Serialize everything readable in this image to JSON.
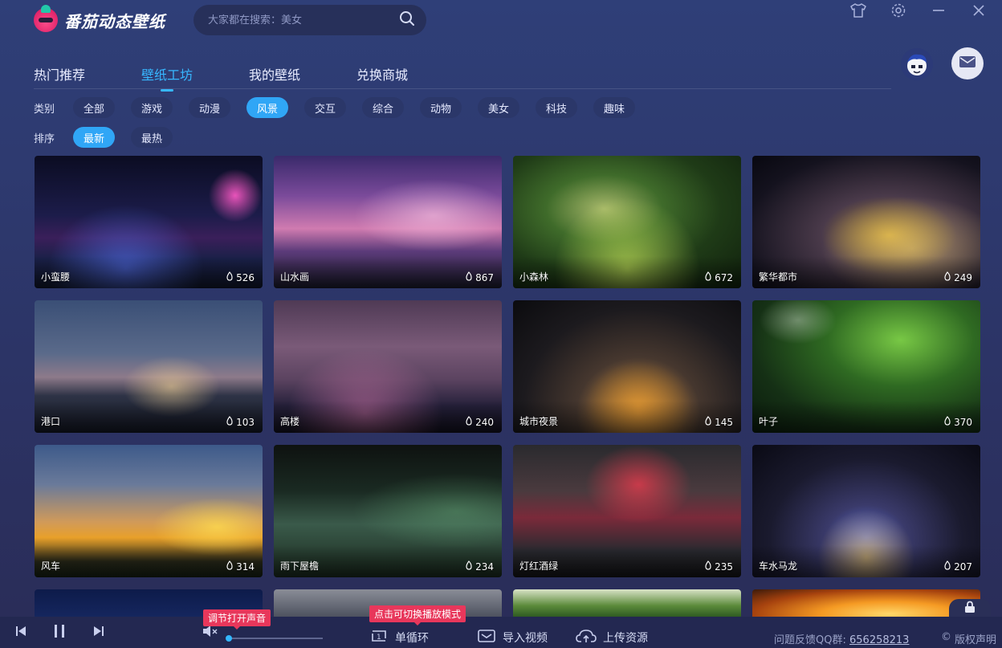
{
  "app": {
    "name": "番茄动态壁纸"
  },
  "search": {
    "placeholder": "大家都在搜索：美女"
  },
  "nav": {
    "tabs": [
      "热门推荐",
      "壁纸工坊",
      "我的壁纸",
      "兑换商城"
    ],
    "active": 1
  },
  "filters": {
    "category_label": "类别",
    "categories": [
      "全部",
      "游戏",
      "动漫",
      "风景",
      "交互",
      "综合",
      "动物",
      "美女",
      "科技",
      "趣味"
    ],
    "category_active": 3,
    "sort_label": "排序",
    "sorts": [
      "最新",
      "最热"
    ],
    "sort_active": 0
  },
  "wallpapers": [
    {
      "title": "小蛮腰",
      "likes": "526",
      "palette": "night-city-purple"
    },
    {
      "title": "山水画",
      "likes": "867",
      "palette": "pink-sunset"
    },
    {
      "title": "小森林",
      "likes": "672",
      "palette": "green-forest"
    },
    {
      "title": "繁华都市",
      "likes": "249",
      "palette": "city-lights"
    },
    {
      "title": "港口",
      "likes": "103",
      "palette": "harbor-dusk"
    },
    {
      "title": "高楼",
      "likes": "240",
      "palette": "tower-dusk"
    },
    {
      "title": "城市夜景",
      "likes": "145",
      "palette": "city-night"
    },
    {
      "title": "叶子",
      "likes": "370",
      "palette": "leaf-green"
    },
    {
      "title": "风车",
      "likes": "314",
      "palette": "windmill-sunset"
    },
    {
      "title": "雨下屋檐",
      "likes": "234",
      "palette": "rain-eaves"
    },
    {
      "title": "灯红酒绿",
      "likes": "235",
      "palette": "neon-street"
    },
    {
      "title": "车水马龙",
      "likes": "207",
      "palette": "city-bay"
    }
  ],
  "player": {
    "volume_tooltip": "调节打开声音",
    "mode_tooltip": "点击可切换播放模式",
    "mode_label": "单循环",
    "import_label": "导入视频",
    "upload_label": "上传资源",
    "volume": 0
  },
  "footer": {
    "feedback_label": "问题反馈QQ群:",
    "qq_group": "656258213",
    "copyright": "版权声明"
  }
}
